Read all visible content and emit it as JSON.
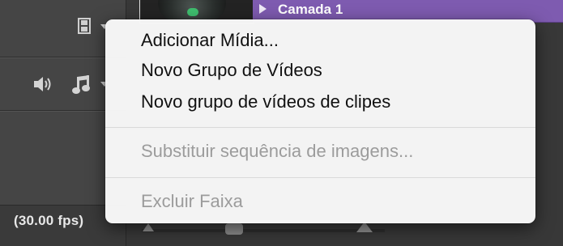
{
  "timeline": {
    "layer_name": "Camada 1",
    "fps_label": "(30.00 fps)"
  },
  "icons": {
    "video_track": "film-icon",
    "audio_mute": "speaker-icon",
    "audio_track": "music-note-icon",
    "expand_layer": "triangle-right-icon"
  },
  "colors": {
    "layer_bar": "#7e5bb0",
    "menu_background": "#f6f6f6",
    "disabled_text": "#9c9c9c"
  },
  "context_menu": {
    "items": [
      {
        "label": "Adicionar Mídia...",
        "enabled": true
      },
      {
        "label": "Novo Grupo de Vídeos",
        "enabled": true
      },
      {
        "label": "Novo grupo de vídeos de clipes",
        "enabled": true
      },
      {
        "label": "Substituir sequência de imagens...",
        "enabled": false
      },
      {
        "label": "Excluir Faixa",
        "enabled": false
      }
    ]
  }
}
